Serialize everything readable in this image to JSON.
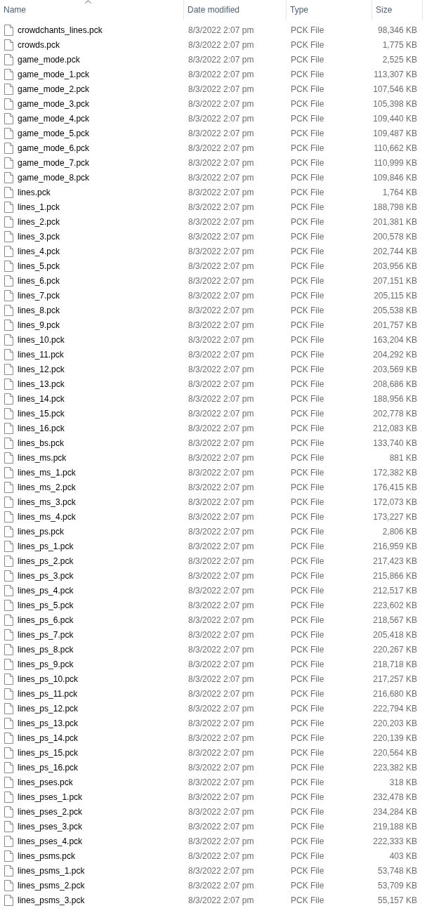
{
  "columns": [
    {
      "label": "Name",
      "sorted": true
    },
    {
      "label": "Date modified",
      "sorted": false
    },
    {
      "label": "Type",
      "sorted": false
    },
    {
      "label": "Size",
      "sorted": false
    }
  ],
  "rows": [
    {
      "name": "crowdchants_lines.pck",
      "date": "8/3/2022 2:07 pm",
      "type": "PCK File",
      "size": "98,346 KB"
    },
    {
      "name": "crowds.pck",
      "date": "8/3/2022 2:07 pm",
      "type": "PCK File",
      "size": "1,775 KB"
    },
    {
      "name": "game_mode.pck",
      "date": "8/3/2022 2:07 pm",
      "type": "PCK File",
      "size": "2,525 KB"
    },
    {
      "name": "game_mode_1.pck",
      "date": "8/3/2022 2:07 pm",
      "type": "PCK File",
      "size": "113,307 KB"
    },
    {
      "name": "game_mode_2.pck",
      "date": "8/3/2022 2:07 pm",
      "type": "PCK File",
      "size": "107,546 KB"
    },
    {
      "name": "game_mode_3.pck",
      "date": "8/3/2022 2:07 pm",
      "type": "PCK File",
      "size": "105,398 KB"
    },
    {
      "name": "game_mode_4.pck",
      "date": "8/3/2022 2:07 pm",
      "type": "PCK File",
      "size": "109,440 KB"
    },
    {
      "name": "game_mode_5.pck",
      "date": "8/3/2022 2:07 pm",
      "type": "PCK File",
      "size": "109,487 KB"
    },
    {
      "name": "game_mode_6.pck",
      "date": "8/3/2022 2:07 pm",
      "type": "PCK File",
      "size": "110,662 KB"
    },
    {
      "name": "game_mode_7.pck",
      "date": "8/3/2022 2:07 pm",
      "type": "PCK File",
      "size": "110,999 KB"
    },
    {
      "name": "game_mode_8.pck",
      "date": "8/3/2022 2:07 pm",
      "type": "PCK File",
      "size": "109,846 KB"
    },
    {
      "name": "lines.pck",
      "date": "8/3/2022 2:07 pm",
      "type": "PCK File",
      "size": "1,764 KB"
    },
    {
      "name": "lines_1.pck",
      "date": "8/3/2022 2:07 pm",
      "type": "PCK File",
      "size": "188,798 KB"
    },
    {
      "name": "lines_2.pck",
      "date": "8/3/2022 2:07 pm",
      "type": "PCK File",
      "size": "201,381 KB"
    },
    {
      "name": "lines_3.pck",
      "date": "8/3/2022 2:07 pm",
      "type": "PCK File",
      "size": "200,578 KB"
    },
    {
      "name": "lines_4.pck",
      "date": "8/3/2022 2:07 pm",
      "type": "PCK File",
      "size": "202,744 KB"
    },
    {
      "name": "lines_5.pck",
      "date": "8/3/2022 2:07 pm",
      "type": "PCK File",
      "size": "203,956 KB"
    },
    {
      "name": "lines_6.pck",
      "date": "8/3/2022 2:07 pm",
      "type": "PCK File",
      "size": "207,151 KB"
    },
    {
      "name": "lines_7.pck",
      "date": "8/3/2022 2:07 pm",
      "type": "PCK File",
      "size": "205,115 KB"
    },
    {
      "name": "lines_8.pck",
      "date": "8/3/2022 2:07 pm",
      "type": "PCK File",
      "size": "205,538 KB"
    },
    {
      "name": "lines_9.pck",
      "date": "8/3/2022 2:07 pm",
      "type": "PCK File",
      "size": "201,757 KB"
    },
    {
      "name": "lines_10.pck",
      "date": "8/3/2022 2:07 pm",
      "type": "PCK File",
      "size": "163,204 KB"
    },
    {
      "name": "lines_11.pck",
      "date": "8/3/2022 2:07 pm",
      "type": "PCK File",
      "size": "204,292 KB"
    },
    {
      "name": "lines_12.pck",
      "date": "8/3/2022 2:07 pm",
      "type": "PCK File",
      "size": "203,569 KB"
    },
    {
      "name": "lines_13.pck",
      "date": "8/3/2022 2:07 pm",
      "type": "PCK File",
      "size": "208,686 KB"
    },
    {
      "name": "lines_14.pck",
      "date": "8/3/2022 2:07 pm",
      "type": "PCK File",
      "size": "188,956 KB"
    },
    {
      "name": "lines_15.pck",
      "date": "8/3/2022 2:07 pm",
      "type": "PCK File",
      "size": "202,778 KB"
    },
    {
      "name": "lines_16.pck",
      "date": "8/3/2022 2:07 pm",
      "type": "PCK File",
      "size": "212,083 KB"
    },
    {
      "name": "lines_bs.pck",
      "date": "8/3/2022 2:07 pm",
      "type": "PCK File",
      "size": "133,740 KB"
    },
    {
      "name": "lines_ms.pck",
      "date": "8/3/2022 2:07 pm",
      "type": "PCK File",
      "size": "881 KB"
    },
    {
      "name": "lines_ms_1.pck",
      "date": "8/3/2022 2:07 pm",
      "type": "PCK File",
      "size": "172,382 KB"
    },
    {
      "name": "lines_ms_2.pck",
      "date": "8/3/2022 2:07 pm",
      "type": "PCK File",
      "size": "176,415 KB"
    },
    {
      "name": "lines_ms_3.pck",
      "date": "8/3/2022 2:07 pm",
      "type": "PCK File",
      "size": "172,073 KB"
    },
    {
      "name": "lines_ms_4.pck",
      "date": "8/3/2022 2:07 pm",
      "type": "PCK File",
      "size": "173,227 KB"
    },
    {
      "name": "lines_ps.pck",
      "date": "8/3/2022 2:07 pm",
      "type": "PCK File",
      "size": "2,806 KB"
    },
    {
      "name": "lines_ps_1.pck",
      "date": "8/3/2022 2:07 pm",
      "type": "PCK File",
      "size": "216,959 KB"
    },
    {
      "name": "lines_ps_2.pck",
      "date": "8/3/2022 2:07 pm",
      "type": "PCK File",
      "size": "217,423 KB"
    },
    {
      "name": "lines_ps_3.pck",
      "date": "8/3/2022 2:07 pm",
      "type": "PCK File",
      "size": "215,866 KB"
    },
    {
      "name": "lines_ps_4.pck",
      "date": "8/3/2022 2:07 pm",
      "type": "PCK File",
      "size": "212,517 KB"
    },
    {
      "name": "lines_ps_5.pck",
      "date": "8/3/2022 2:07 pm",
      "type": "PCK File",
      "size": "223,602 KB"
    },
    {
      "name": "lines_ps_6.pck",
      "date": "8/3/2022 2:07 pm",
      "type": "PCK File",
      "size": "218,567 KB"
    },
    {
      "name": "lines_ps_7.pck",
      "date": "8/3/2022 2:07 pm",
      "type": "PCK File",
      "size": "205,418 KB"
    },
    {
      "name": "lines_ps_8.pck",
      "date": "8/3/2022 2:07 pm",
      "type": "PCK File",
      "size": "220,267 KB"
    },
    {
      "name": "lines_ps_9.pck",
      "date": "8/3/2022 2:07 pm",
      "type": "PCK File",
      "size": "218,718 KB"
    },
    {
      "name": "lines_ps_10.pck",
      "date": "8/3/2022 2:07 pm",
      "type": "PCK File",
      "size": "217,257 KB"
    },
    {
      "name": "lines_ps_11.pck",
      "date": "8/3/2022 2:07 pm",
      "type": "PCK File",
      "size": "216,680 KB"
    },
    {
      "name": "lines_ps_12.pck",
      "date": "8/3/2022 2:07 pm",
      "type": "PCK File",
      "size": "222,794 KB"
    },
    {
      "name": "lines_ps_13.pck",
      "date": "8/3/2022 2:07 pm",
      "type": "PCK File",
      "size": "220,203 KB"
    },
    {
      "name": "lines_ps_14.pck",
      "date": "8/3/2022 2:07 pm",
      "type": "PCK File",
      "size": "220,139 KB"
    },
    {
      "name": "lines_ps_15.pck",
      "date": "8/3/2022 2:07 pm",
      "type": "PCK File",
      "size": "220,564 KB"
    },
    {
      "name": "lines_ps_16.pck",
      "date": "8/3/2022 2:07 pm",
      "type": "PCK File",
      "size": "223,382 KB"
    },
    {
      "name": "lines_pses.pck",
      "date": "8/3/2022 2:07 pm",
      "type": "PCK File",
      "size": "318 KB"
    },
    {
      "name": "lines_pses_1.pck",
      "date": "8/3/2022 2:07 pm",
      "type": "PCK File",
      "size": "232,478 KB"
    },
    {
      "name": "lines_pses_2.pck",
      "date": "8/3/2022 2:07 pm",
      "type": "PCK File",
      "size": "234,284 KB"
    },
    {
      "name": "lines_pses_3.pck",
      "date": "8/3/2022 2:07 pm",
      "type": "PCK File",
      "size": "219,188 KB"
    },
    {
      "name": "lines_pses_4.pck",
      "date": "8/3/2022 2:07 pm",
      "type": "PCK File",
      "size": "222,333 KB"
    },
    {
      "name": "lines_psms.pck",
      "date": "8/3/2022 2:07 pm",
      "type": "PCK File",
      "size": "403 KB"
    },
    {
      "name": "lines_psms_1.pck",
      "date": "8/3/2022 2:07 pm",
      "type": "PCK File",
      "size": "53,748 KB"
    },
    {
      "name": "lines_psms_2.pck",
      "date": "8/3/2022 2:07 pm",
      "type": "PCK File",
      "size": "53,709 KB"
    },
    {
      "name": "lines_psms_3.pck",
      "date": "8/3/2022 2:07 pm",
      "type": "PCK File",
      "size": "55,157 KB"
    }
  ]
}
